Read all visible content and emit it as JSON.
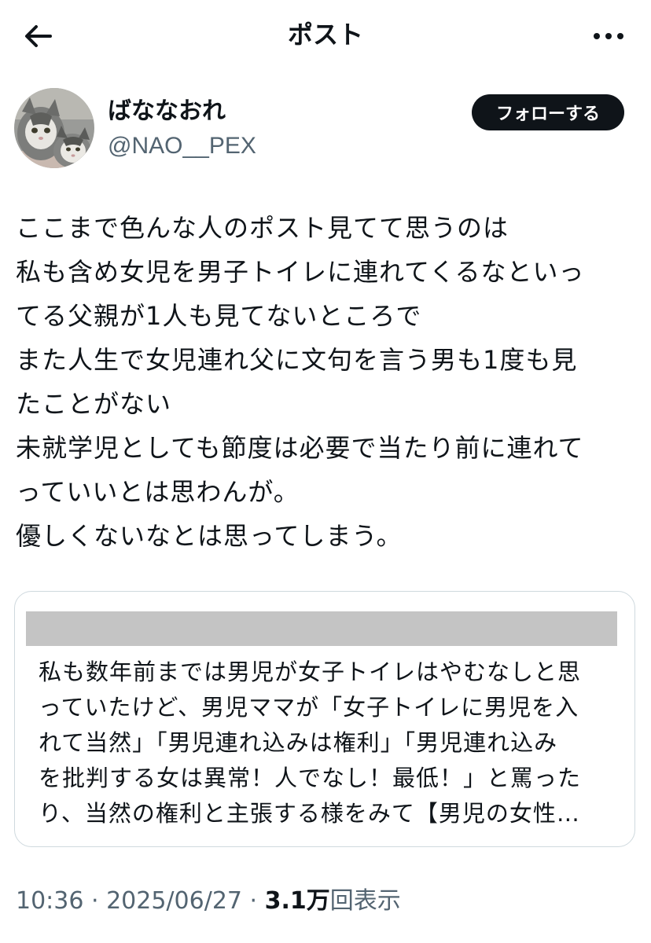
{
  "header": {
    "title": "ポスト",
    "back_icon": "arrow-left-icon",
    "more_icon": "more-horizontal-icon"
  },
  "author": {
    "display_name": "ばななおれ",
    "handle": "@NAO__PEX",
    "avatar": "cat-photo-avatar"
  },
  "follow_button": {
    "label": "フォローする"
  },
  "post": {
    "lines": [
      "ここまで色んな人のポスト見てて思うのは",
      "私も含め女児を男子トイレに連れてくるなといっ",
      "てる父親が1人も見てないところで",
      "また人生で女児連れ父に文句を言う男も1度も見",
      "たことがない",
      "未就学児としても節度は必要で当たり前に連れて",
      "っていいとは思わんが。",
      "優しくないなとは思ってしまう。"
    ]
  },
  "quoted_post": {
    "lines": [
      "私も数年前までは男児が女子トイレはやむなしと思",
      "っていたけど、男児ママが「女子トイレに男児を入",
      "れて当然」「男児連れ込みは権利」「男児連れ込み",
      "を批判する女は異常！人でなし！最低！」と罵った",
      "り、当然の権利と主張する様をみて【男児の女性…"
    ]
  },
  "meta": {
    "time": "10:36",
    "separator": " · ",
    "date": "2025/06/27",
    "views_count": "3.1万",
    "views_label": "回表示"
  },
  "colors": {
    "text": "#0f1419",
    "secondary": "#536471",
    "border": "#cfd9de",
    "redacted": "#c4c4c4"
  }
}
